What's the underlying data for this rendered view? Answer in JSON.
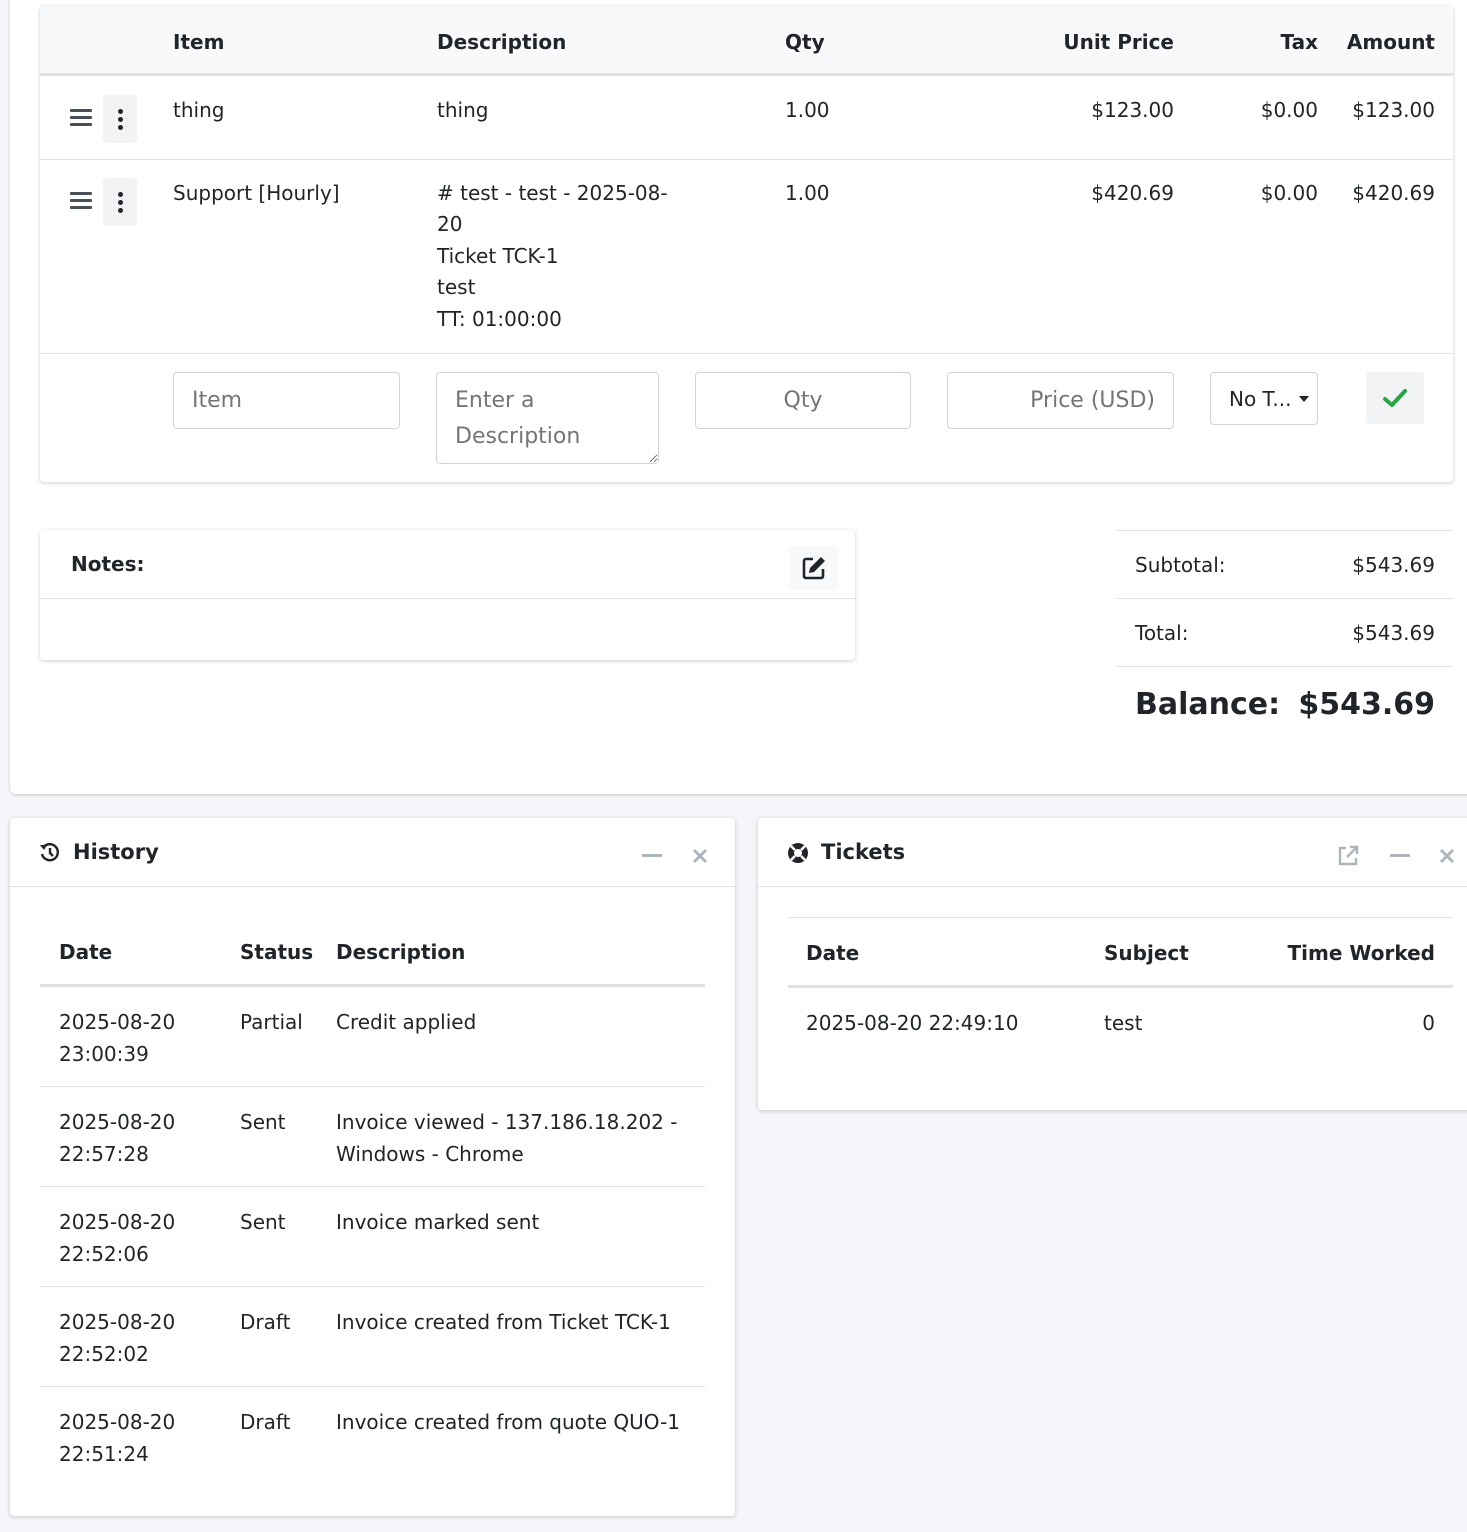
{
  "items_table": {
    "headers": {
      "item": "Item",
      "description": "Description",
      "qty": "Qty",
      "unit_price": "Unit Price",
      "tax": "Tax",
      "amount": "Amount"
    },
    "rows": [
      {
        "item": "thing",
        "description": [
          "thing"
        ],
        "qty": "1.00",
        "unit_price": "$123.00",
        "tax": "$0.00",
        "amount": "$123.00"
      },
      {
        "item": "Support [Hourly]",
        "description": [
          "# test - test - 2025-08-",
          "20",
          "Ticket TCK-1",
          "test",
          "TT: 01:00:00"
        ],
        "qty": "1.00",
        "unit_price": "$420.69",
        "tax": "$0.00",
        "amount": "$420.69"
      }
    ],
    "new_row": {
      "item_placeholder": "Item",
      "description_placeholder": "Enter a Description",
      "qty_placeholder": "Qty",
      "price_placeholder": "Price (USD)",
      "tax_selected": "No T..."
    }
  },
  "notes": {
    "title": "Notes:"
  },
  "totals": {
    "subtotal_label": "Subtotal:",
    "subtotal_value": "$543.69",
    "total_label": "Total:",
    "total_value": "$543.69",
    "balance_label": "Balance:",
    "balance_value": "$543.69"
  },
  "history": {
    "title": "History",
    "headers": {
      "date": "Date",
      "status": "Status",
      "description": "Description"
    },
    "rows": [
      {
        "date": "2025-08-20",
        "time": "23:00:39",
        "status": "Partial",
        "description": [
          "Credit applied"
        ]
      },
      {
        "date": "2025-08-20",
        "time": "22:57:28",
        "status": "Sent",
        "description": [
          "Invoice viewed - 137.186.18.202 -",
          "Windows - Chrome"
        ]
      },
      {
        "date": "2025-08-20",
        "time": "22:52:06",
        "status": "Sent",
        "description": [
          "Invoice marked sent"
        ]
      },
      {
        "date": "2025-08-20",
        "time": "22:52:02",
        "status": "Draft",
        "description": [
          "Invoice created from Ticket TCK-1"
        ]
      },
      {
        "date": "2025-08-20",
        "time": "22:51:24",
        "status": "Draft",
        "description": [
          "Invoice created from quote QUO-1"
        ]
      }
    ]
  },
  "tickets": {
    "title": "Tickets",
    "headers": {
      "date": "Date",
      "subject": "Subject",
      "time_worked": "Time Worked"
    },
    "rows": [
      {
        "date": "2025-08-20 22:49:10",
        "subject": "test",
        "time_worked": "0"
      }
    ]
  },
  "colors": {
    "success": "#28a745",
    "border": "#dee2e6",
    "muted": "#8a939b"
  }
}
